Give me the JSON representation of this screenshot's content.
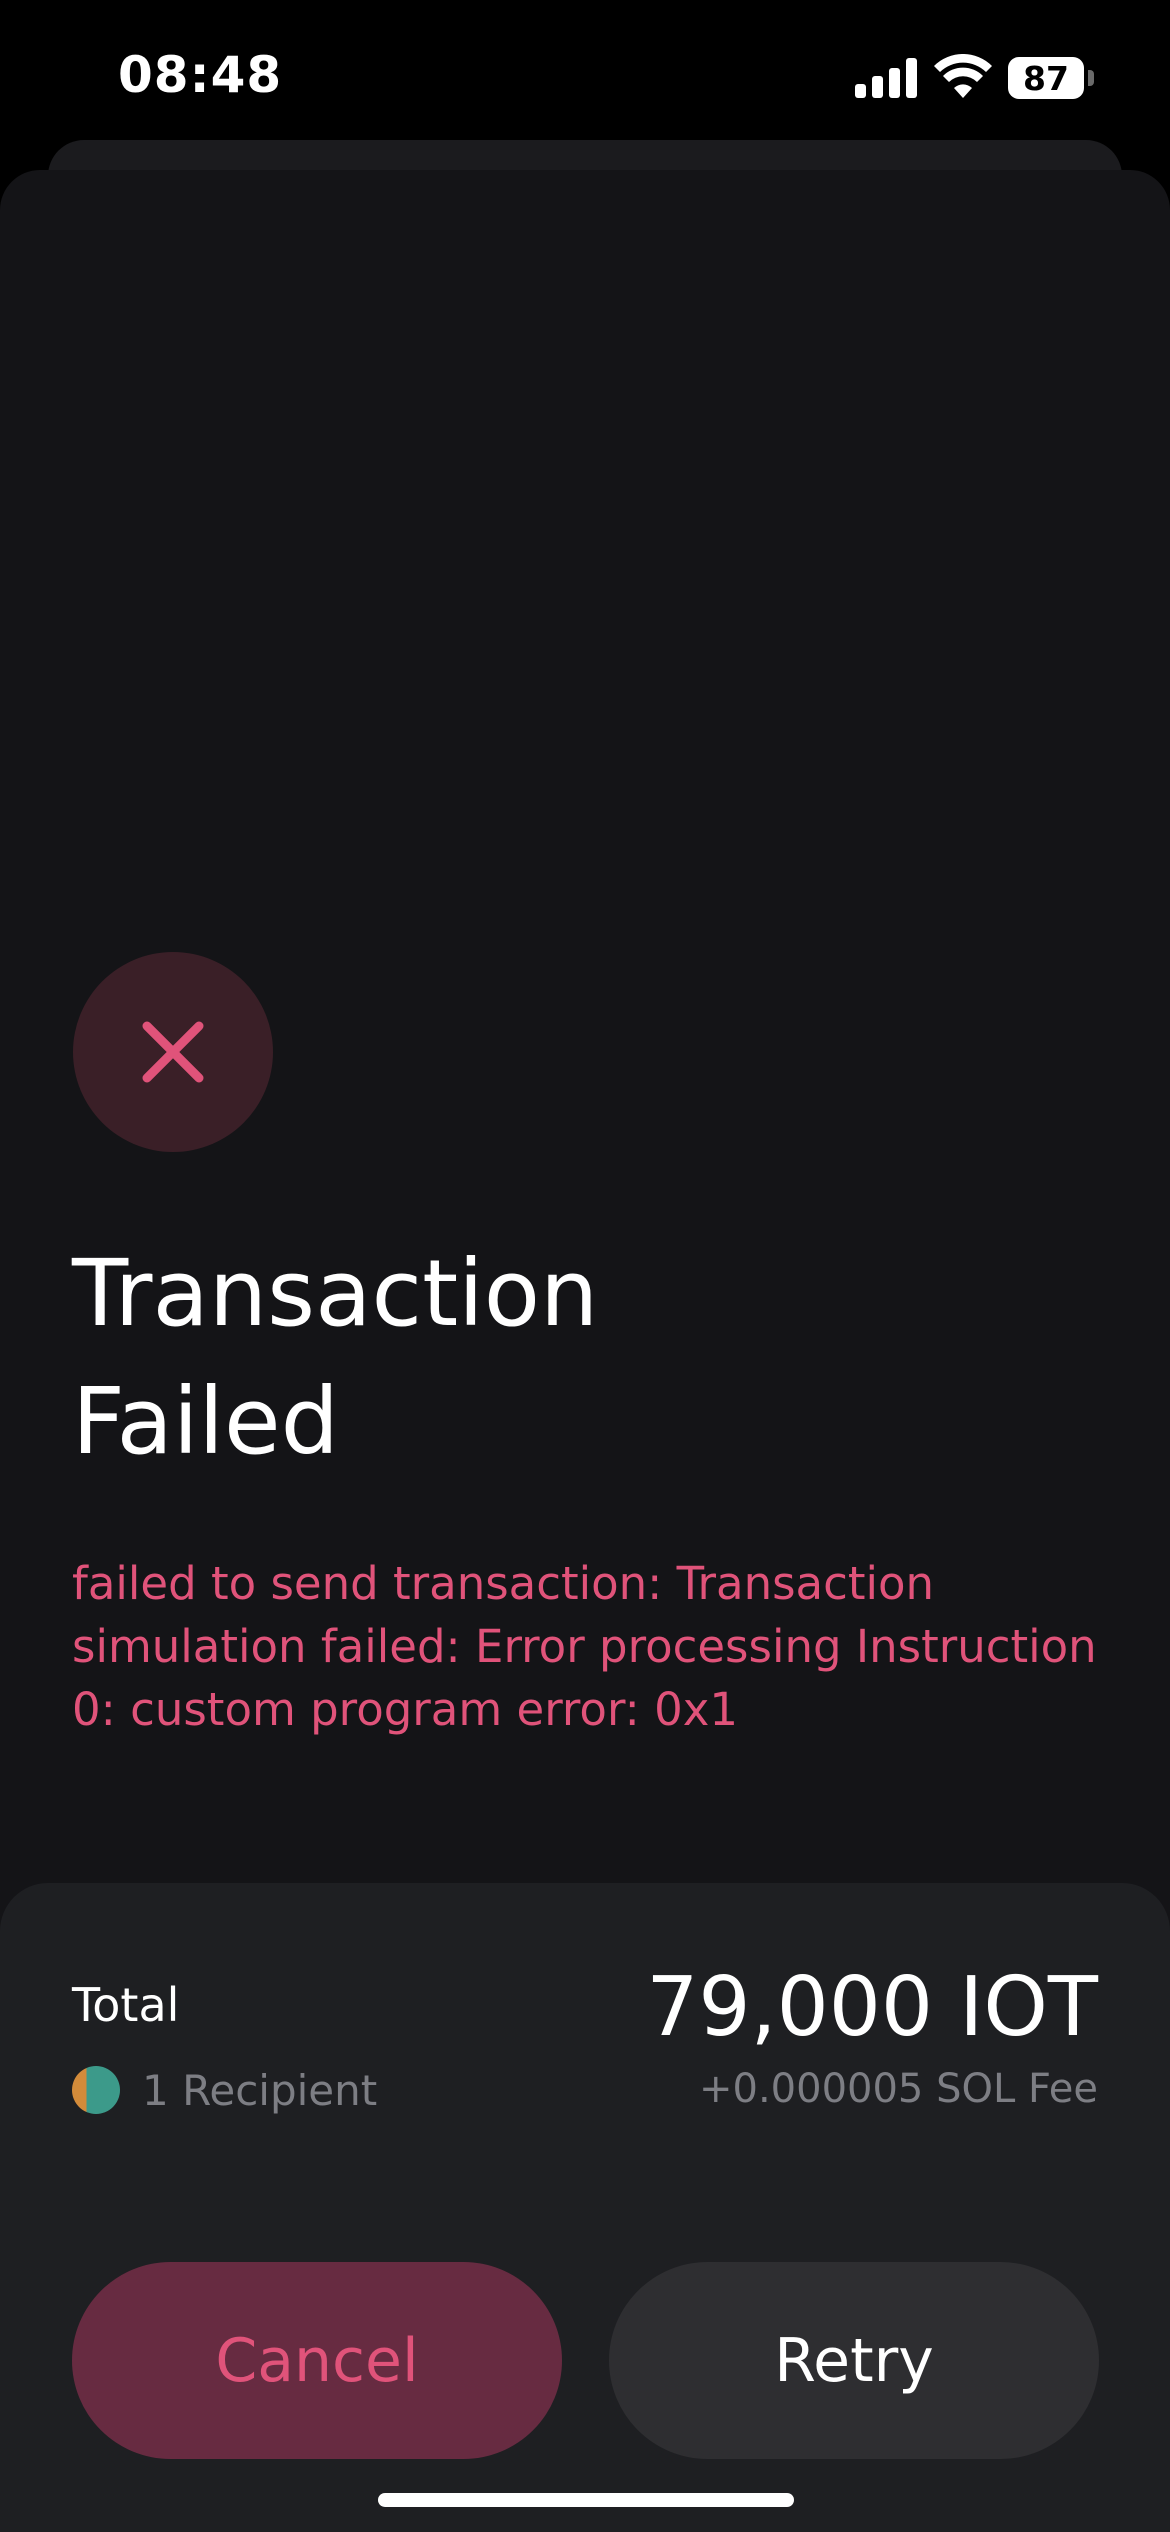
{
  "status_bar": {
    "time": "08:48",
    "battery_level": "87",
    "signal_icon": "cellular-signal-icon",
    "wifi_icon": "wifi-icon"
  },
  "result": {
    "icon": "close-icon",
    "icon_color": "#e0537a",
    "title_line1": "Transaction",
    "title_line2": "Failed",
    "error_message": "failed to send transaction: Transaction simulation failed: Error processing Instruction 0: custom program error: 0x1"
  },
  "summary": {
    "total_label": "Total",
    "total_amount": "79,000 IOT",
    "recipients_text": "1 Recipient",
    "fee_text": "+0.000005 SOL Fee"
  },
  "actions": {
    "cancel_label": "Cancel",
    "retry_label": "Retry",
    "cancel_color": "#672b41",
    "retry_color": "#2e2e31"
  }
}
